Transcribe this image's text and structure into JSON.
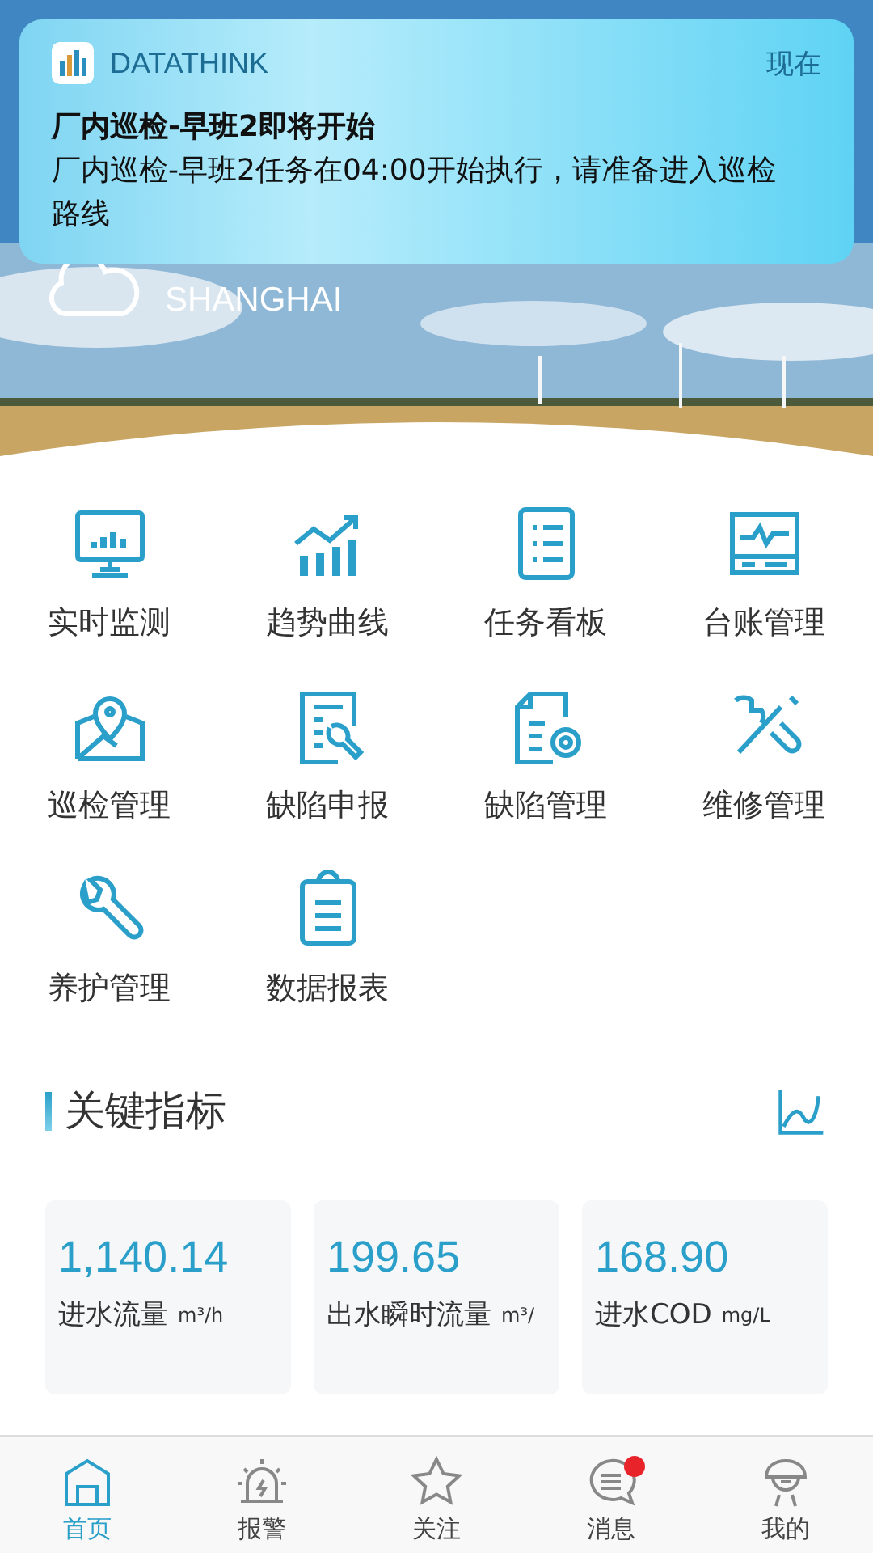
{
  "notification": {
    "app": "DATATHINK",
    "time": "现在",
    "title": "厂内巡检-早班2即将开始",
    "body": "厂内巡检-早班2任务在04:00开始执行，请准备进入巡检路线"
  },
  "location": {
    "city": "SHANGHAI"
  },
  "menu": [
    {
      "label": "实时监测"
    },
    {
      "label": "趋势曲线"
    },
    {
      "label": "任务看板"
    },
    {
      "label": "台账管理"
    },
    {
      "label": "巡检管理"
    },
    {
      "label": "缺陷申报"
    },
    {
      "label": "缺陷管理"
    },
    {
      "label": "维修管理"
    },
    {
      "label": "养护管理"
    },
    {
      "label": "数据报表"
    }
  ],
  "section": {
    "title": "关键指标"
  },
  "metrics": [
    {
      "value": "1,140.14",
      "label": "进水流量",
      "unit": "m³/h"
    },
    {
      "value": "199.65",
      "label": "出水瞬时流量",
      "unit": "m³/"
    },
    {
      "value": "168.90",
      "label": "进水COD",
      "unit": "mg/L"
    }
  ],
  "tabs": [
    {
      "label": "首页",
      "selected": true,
      "badge": false
    },
    {
      "label": "报警",
      "selected": false,
      "badge": false
    },
    {
      "label": "关注",
      "selected": false,
      "badge": false
    },
    {
      "label": "消息",
      "selected": false,
      "badge": true
    },
    {
      "label": "我的",
      "selected": false,
      "badge": false
    }
  ]
}
